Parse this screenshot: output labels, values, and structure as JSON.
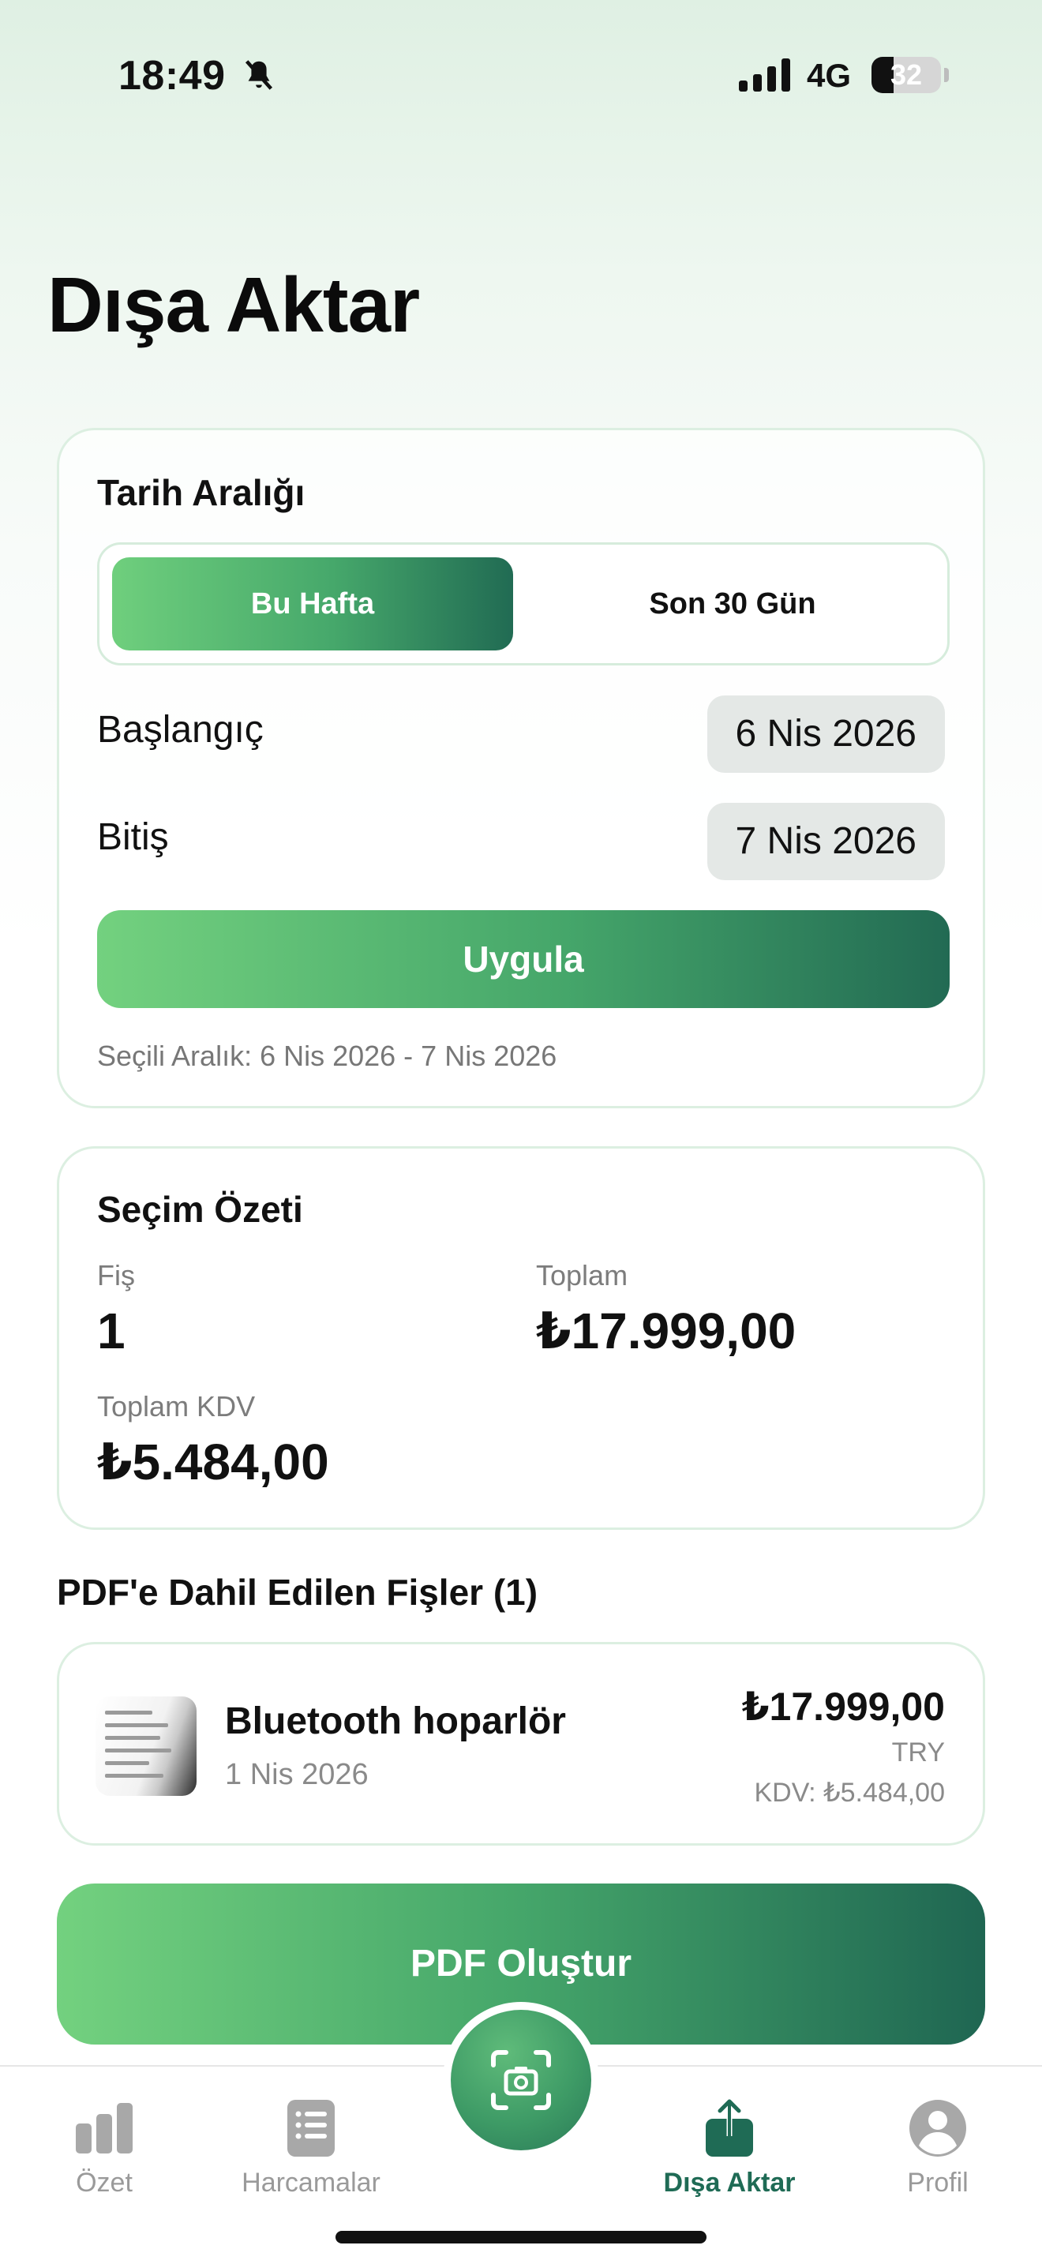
{
  "status_bar": {
    "time": "18:49",
    "network": "4G",
    "battery": "32",
    "battery_level": 0.32
  },
  "page_title": "Dışa Aktar",
  "date_range": {
    "title": "Tarih Aralığı",
    "segments": [
      "Bu Hafta",
      "Son 30 Gün"
    ],
    "selected_segment": "Bu Hafta",
    "start_label": "Başlangıç",
    "start_value": "6 Nis 2026",
    "end_label": "Bitiş",
    "end_value": "7 Nis 2026",
    "apply_label": "Uygula",
    "selected_range_text": "Seçili Aralık: 6 Nis 2026 - 7 Nis 2026"
  },
  "summary": {
    "title": "Seçim Özeti",
    "receipt_count_label": "Fiş",
    "receipt_count_value": "1",
    "total_label": "Toplam",
    "total_value": "₺17.999,00",
    "vat_label": "Toplam KDV",
    "vat_value": "₺5.484,00"
  },
  "included_section_title": "PDF'e Dahil Edilen Fişler (1)",
  "receipts": [
    {
      "name": "Bluetooth hoparlör",
      "date": "1 Nis 2026",
      "amount": "₺17.999,00",
      "currency": "TRY",
      "vat": "KDV: ₺5.484,00"
    }
  ],
  "create_pdf_label": "PDF Oluştur",
  "tab_bar": {
    "tabs": [
      {
        "label": "Özet",
        "icon": "bar-chart-icon"
      },
      {
        "label": "Harcamalar",
        "icon": "list-icon"
      },
      {
        "label": "Dışa Aktar",
        "icon": "share-icon"
      },
      {
        "label": "Profil",
        "icon": "person-icon"
      }
    ],
    "active_tab": "Dışa Aktar",
    "center_icon": "camera-scan-icon"
  },
  "colors": {
    "accent_light": "#73d17f",
    "accent_dark": "#1f6b55",
    "inactive_tab": "#9a9a9a"
  }
}
